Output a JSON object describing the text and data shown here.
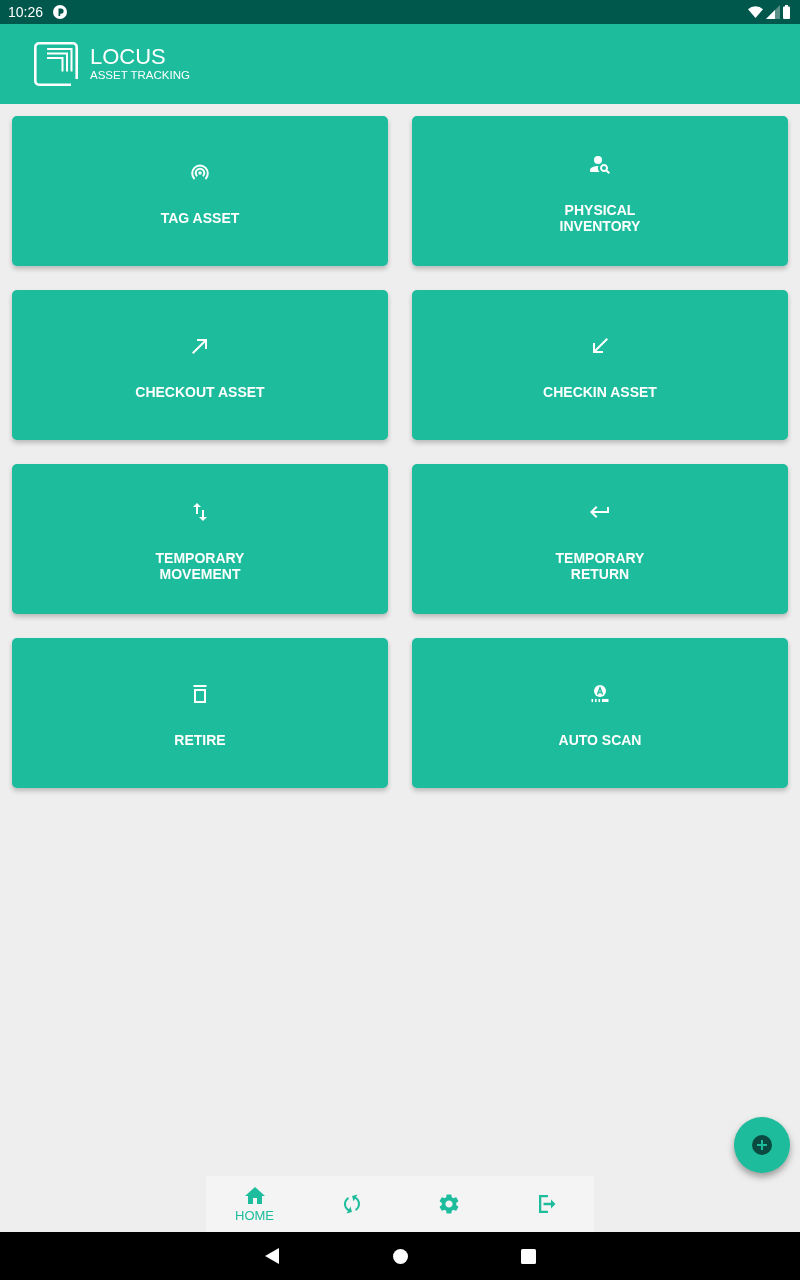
{
  "status_bar": {
    "time": "10:26"
  },
  "app_bar": {
    "title": "LOCUS",
    "subtitle": "ASSET TRACKING"
  },
  "tiles": [
    {
      "label": "TAG ASSET"
    },
    {
      "label": "PHYSICAL\nINVENTORY"
    },
    {
      "label": "CHECKOUT ASSET"
    },
    {
      "label": "CHECKIN ASSET"
    },
    {
      "label": "TEMPORARY\nMOVEMENT"
    },
    {
      "label": "TEMPORARY\nRETURN"
    },
    {
      "label": "RETIRE"
    },
    {
      "label": "AUTO SCAN"
    }
  ],
  "bottom_nav": {
    "items": [
      {
        "label": "HOME",
        "selected": true
      },
      {
        "selected": false
      },
      {
        "selected": false
      },
      {
        "selected": false
      }
    ]
  }
}
